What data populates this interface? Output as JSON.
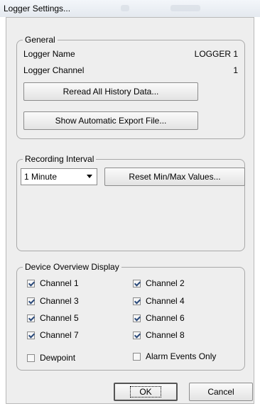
{
  "window": {
    "title": "Logger Settings..."
  },
  "general": {
    "legend": "General",
    "logger_name_label": "Logger Name",
    "logger_name_value": "LOGGER 1",
    "logger_channel_label": "Logger Channel",
    "logger_channel_value": "1",
    "reread_button": "Reread All History Data...",
    "export_button": "Show Automatic Export File..."
  },
  "recording": {
    "legend": "Recording Interval",
    "interval_value": "1 Minute",
    "reset_button": "Reset Min/Max Values..."
  },
  "overview": {
    "legend": "Device Overview Display",
    "channels": [
      {
        "label": "Channel 1",
        "checked": true
      },
      {
        "label": "Channel 2",
        "checked": true
      },
      {
        "label": "Channel 3",
        "checked": true
      },
      {
        "label": "Channel 4",
        "checked": true
      },
      {
        "label": "Channel 5",
        "checked": true
      },
      {
        "label": "Channel 6",
        "checked": true
      },
      {
        "label": "Channel 7",
        "checked": true
      },
      {
        "label": "Channel 8",
        "checked": true
      }
    ],
    "dewpoint": {
      "label": "Dewpoint",
      "checked": false
    },
    "alarm_only": {
      "label": "Alarm Events Only",
      "checked": false
    }
  },
  "footer": {
    "ok_button": "OK",
    "cancel_button": "Cancel"
  }
}
